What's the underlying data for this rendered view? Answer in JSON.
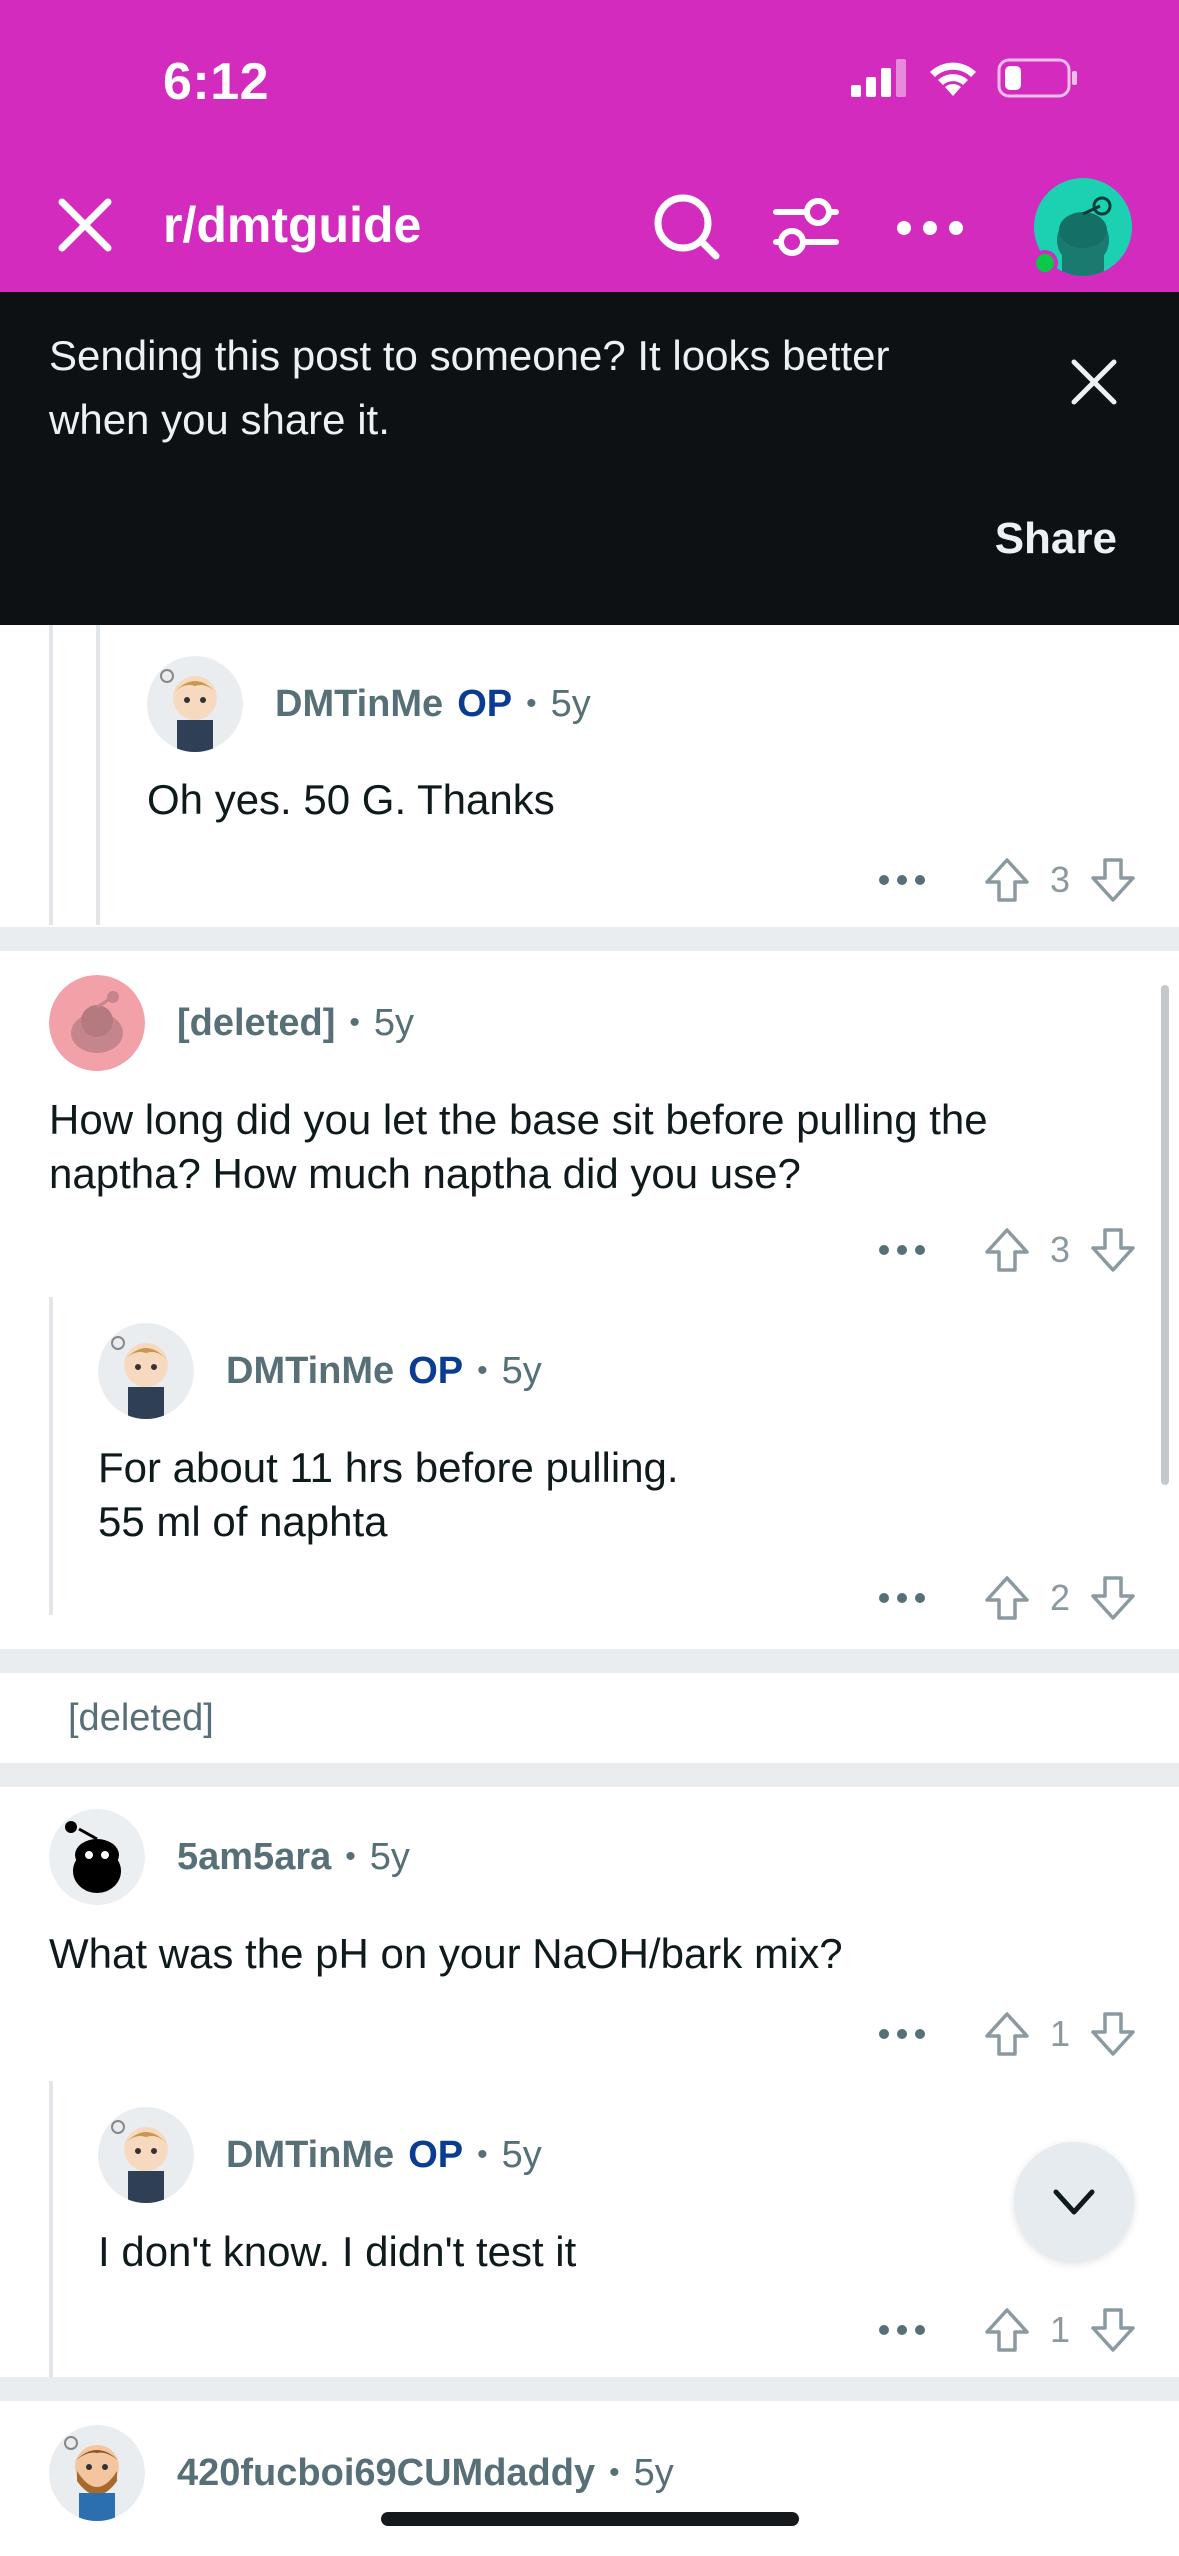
{
  "status_bar": {
    "time": "6:12"
  },
  "nav": {
    "title": "r/dmtguide"
  },
  "banner": {
    "message": "Sending this post to someone? It looks better when you share it.",
    "share_label": "Share"
  },
  "colors": {
    "brand": "#d42bbf",
    "op": "#0a3d91",
    "meta": "#576f76"
  },
  "comments": [
    {
      "user": "DMTinMe",
      "op": "OP",
      "age": "5y",
      "body": "Oh yes. 50 G. Thanks",
      "score": "3"
    },
    {
      "user": "[deleted]",
      "age": "5y",
      "body": "How long did you let the base sit before pulling the naptha?  How much naptha did you use?",
      "score": "3"
    },
    {
      "user": "DMTinMe",
      "op": "OP",
      "age": "5y",
      "body": "For about 11 hrs before pulling.\n55 ml of naphta",
      "score": "2"
    },
    {
      "deleted_text": "[deleted]"
    },
    {
      "user": "5am5ara",
      "age": "5y",
      "body": "What was the pH on your NaOH/bark mix?",
      "score": "1"
    },
    {
      "user": "DMTinMe",
      "op": "OP",
      "age": "5y",
      "body": "I don't know. I didn't test it",
      "score": "1"
    },
    {
      "user": "420fucboi69CUMdaddy",
      "age": "5y"
    }
  ],
  "icons": {
    "close": "close-icon",
    "search": "search-icon",
    "filter": "filter-icon",
    "more": "more-icon",
    "upvote": "upvote-icon",
    "downvote": "downvote-icon",
    "chevron": "chevron-down-icon"
  }
}
